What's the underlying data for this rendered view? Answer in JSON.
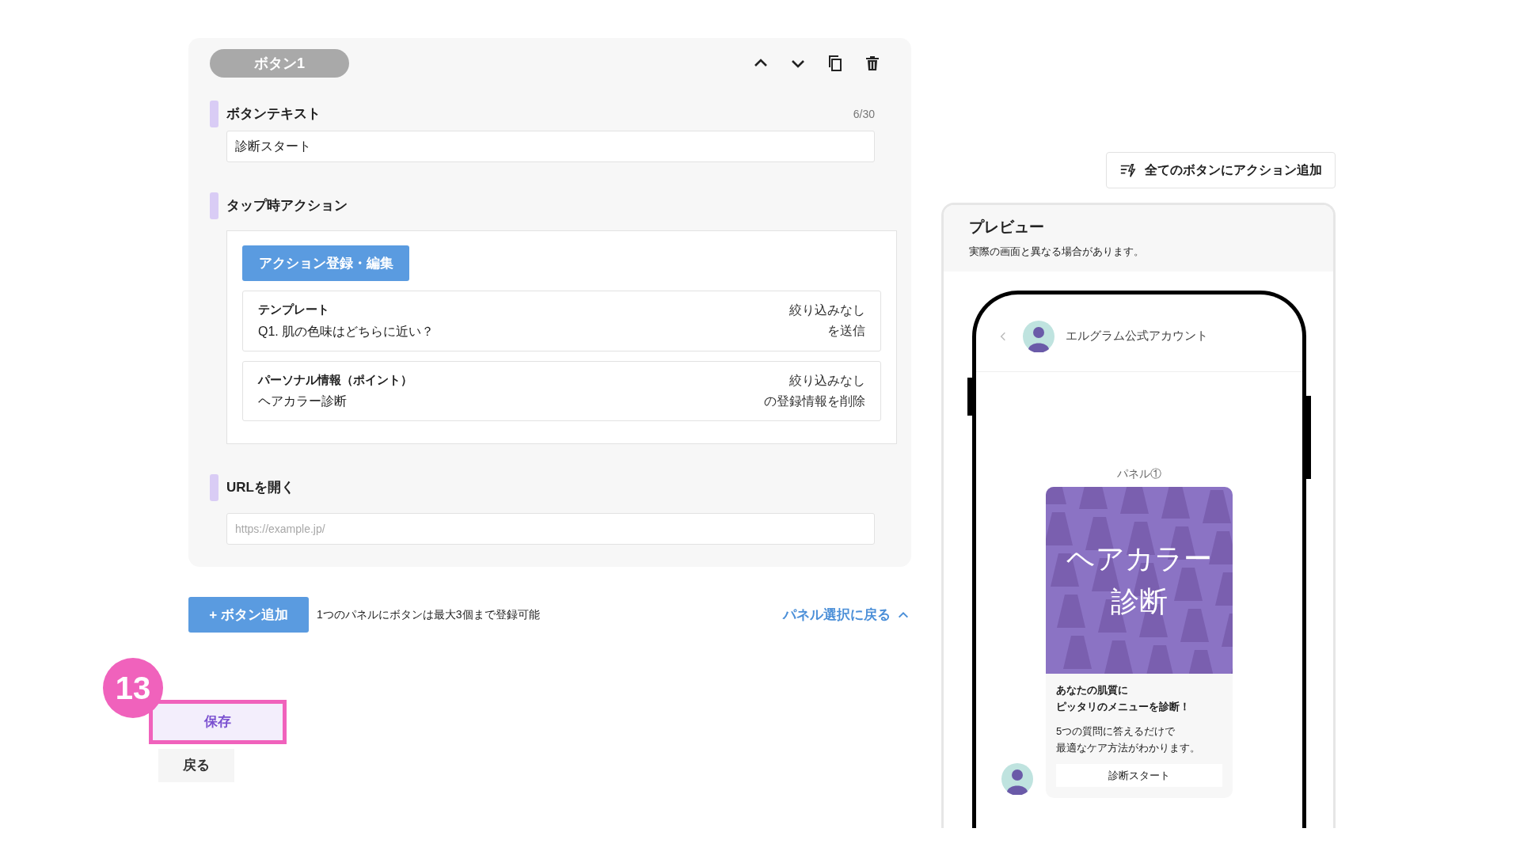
{
  "button_card": {
    "title": "ボタン1",
    "button_text": {
      "label": "ボタンテキスト",
      "counter": "6/30",
      "value": "診断スタート"
    },
    "tap_action": {
      "label": "タップ時アクション",
      "edit_button": "アクション登録・編集",
      "actions": [
        {
          "type": "テンプレート",
          "name": "Q1. 肌の色味はどちらに近い？",
          "detail_1": "絞り込みなし",
          "detail_2": "を送信"
        },
        {
          "type": "パーソナル情報（ポイント）",
          "name": "ヘアカラー診断",
          "detail_1": "絞り込みなし",
          "detail_2": "の登録情報を削除"
        }
      ]
    },
    "url": {
      "label": "URLを開く",
      "placeholder": "https://example.jp/"
    }
  },
  "add_button": "+ ボタン追加",
  "limit_note": "1つのパネルにボタンは最大3個まで登録可能",
  "back_to_panels": "パネル選択に戻る",
  "step_badge": "13",
  "save_button": {
    "label": "保存",
    "highlighted": true
  },
  "back_button": "戻る",
  "add_action_all_button": "全てのボタンにアクション追加",
  "preview": {
    "title": "プレビュー",
    "note": "実際の画面と異なる場合があります。",
    "account_name": "エルグラム公式アカウント",
    "panel_label": "パネル①",
    "banner_text": [
      "ヘアカラー",
      "診断"
    ],
    "card_title": [
      "あなたの肌質に",
      "ピッタリのメニューを診断！"
    ],
    "card_body": [
      "5つの質問に答えるだけで",
      "最適なケア方法がわかります。"
    ],
    "card_button": "診断スタート"
  }
}
